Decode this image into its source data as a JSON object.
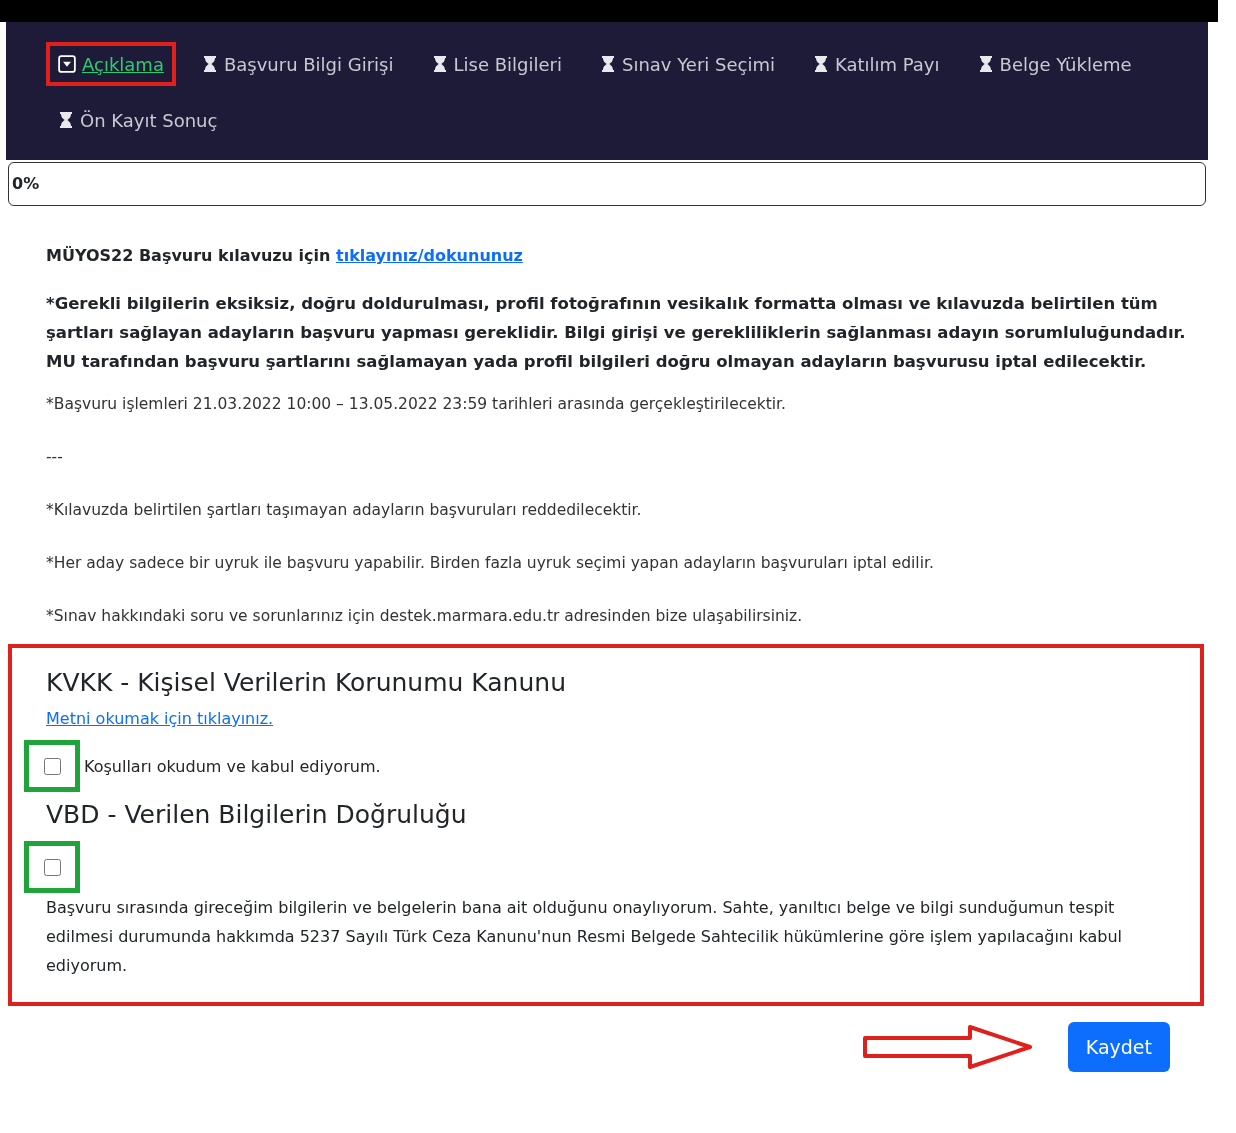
{
  "tabs": [
    {
      "label": "Açıklama",
      "selected": true,
      "highlighted": true
    },
    {
      "label": "Başvuru Bilgi Girişi",
      "selected": false,
      "highlighted": false
    },
    {
      "label": "Lise Bilgileri",
      "selected": false,
      "highlighted": false
    },
    {
      "label": "Sınav Yeri Seçimi",
      "selected": false,
      "highlighted": false
    },
    {
      "label": "Katılım Payı",
      "selected": false,
      "highlighted": false
    },
    {
      "label": "Belge Yükleme",
      "selected": false,
      "highlighted": false
    },
    {
      "label": "Ön Kayıt Sonuç",
      "selected": false,
      "highlighted": false
    }
  ],
  "progress": {
    "label": "0%",
    "level": 0
  },
  "intro": {
    "text": "MÜYOS22 Başvuru kılavuzu için",
    "link": "tıklayınız/dokununuz"
  },
  "warning": "*Gerekli bilgilerin eksiksiz, doğru doldurulması, profil fotoğrafının vesikalık formatta olması ve kılavuzda belirtilen tüm şartları sağlayan adayların başvuru yapması gereklidir. Bilgi girişi ve gerekliliklerin sağlanması adayın sorumluluğundadır. MU tarafından başvuru şartlarını sağlamayan yada profil bilgileri doğru olmayan adayların başvurusu iptal edilecektir.",
  "notes": [
    "*Başvuru işlemleri 21.03.2022 10:00 – 13.05.2022 23:59 tarihleri arasında gerçekleştirilecektir.",
    "---",
    "*Kılavuzda belirtilen şartları taşımayan adayların başvuruları reddedilecektir.",
    "*Her aday sadece bir uyruk ile başvuru yapabilir. Birden fazla uyruk seçimi yapan adayların başvuruları iptal edilir.",
    "*Sınav hakkındaki soru ve sorunlarınız için destek.marmara.edu.tr adresinden bize ulaşabilirsiniz."
  ],
  "consent": {
    "highlighted": true,
    "kvkk": {
      "title": "KVKK - Kişisel Verilerin Korunumu Kanunu",
      "link": "Metni okumak için tıklayınız.",
      "checkbox_label": "Koşulları okudum ve kabul ediyorum.",
      "checked": false,
      "highlighted": true
    },
    "vbd": {
      "title": "VBD - Verilen Bilgilerin Doğruluğu",
      "checked": false,
      "highlighted": true,
      "text": "Başvuru sırasında gireceğim bilgilerin ve belgelerin bana ait olduğunu onaylıyorum. Sahte, yanıltıcı belge ve bilgi sunduğumun tespit edilmesi durumunda hakkımda 5237 Sayılı Türk Ceza Kanunu'nun Resmi Belgede Sahtecilik hükümlerine göre işlem yapılacağını kabul ediyorum."
    }
  },
  "save_button": "Kaydet"
}
